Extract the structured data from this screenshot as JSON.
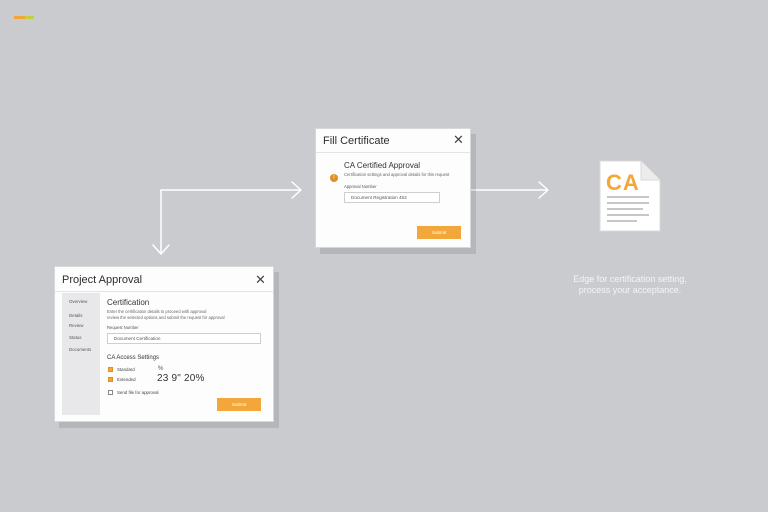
{
  "colors": {
    "background": "#c9cbce",
    "accent": "#f3a73a",
    "accent_dark": "#e38e1d",
    "brand_green": "#c4cf3c",
    "arrow": "#ffffff"
  },
  "certificate_dialog": {
    "title": "Fill Certificate",
    "close_icon": "close-icon",
    "section_title": "CA Certified Approval",
    "warning_icon": "warning-icon",
    "description": "Certification settings and approval details for this request",
    "field_label": "Approval Number",
    "field_value": "Document Registration 453",
    "button": "Submit"
  },
  "approval_dialog": {
    "title": "Project Approval",
    "close_icon": "close-icon",
    "sidebar": [
      "Overview",
      "Details",
      "Review",
      "Status",
      "Documents"
    ],
    "section_title": "Certification",
    "description_1": "Enter the certification details to proceed with approval",
    "description_2": "review the selected options and submit the request for approval",
    "field_label": "Request Number",
    "field_value": "Document Certification",
    "subsection_title": "CA Access Settings",
    "options": [
      {
        "label": "Standard",
        "checked": true
      },
      {
        "label": "Extended",
        "checked": true
      }
    ],
    "percent_symbol": "%",
    "value": "23 9\" 20%",
    "checkbox_label": "Send file for approval",
    "button": "Submit"
  },
  "document_icon": {
    "name": "certificate-document-icon",
    "text": "CA"
  },
  "caption": {
    "line1": "Edge for certification setting,",
    "line2": "process your acceptance."
  }
}
